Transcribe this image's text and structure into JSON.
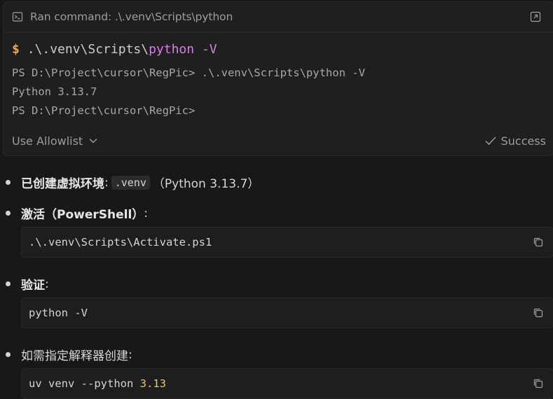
{
  "terminal": {
    "title": "Ran command: .\\.venv\\Scripts\\python",
    "command": {
      "prompt": "$",
      "path_prefix": ".\\.venv\\Scripts\\",
      "executable": "python",
      "flag": "-V"
    },
    "output": [
      "PS D:\\Project\\cursor\\RegPic> .\\.venv\\Scripts\\python -V",
      "Python 3.13.7",
      "PS D:\\Project\\cursor\\RegPic>"
    ],
    "allowlist_label": "Use Allowlist",
    "status_label": "Success"
  },
  "bullets": [
    {
      "bold": "已创建虚拟环境",
      "sep": ":",
      "code": ".venv",
      "suffix": "（Python 3.13.7）"
    },
    {
      "bold": "激活（PowerShell）",
      "sep": ":"
    },
    {
      "bold": "验证",
      "sep": ":"
    },
    {
      "text": "如需指定解释器创建",
      "sep": ":"
    }
  ],
  "code_blocks": [
    {
      "code": ".\\.venv\\Scripts\\Activate.ps1"
    },
    {
      "code": "python -V"
    },
    {
      "code_prefix": "uv venv --python ",
      "code_number": "3.13"
    }
  ],
  "colors": {
    "background": "#181818",
    "card": "#1f1f1f",
    "prompt_orange": "#e4a85a",
    "keyword_purple": "#d77ee8",
    "number_yellow": "#e6c07b"
  }
}
